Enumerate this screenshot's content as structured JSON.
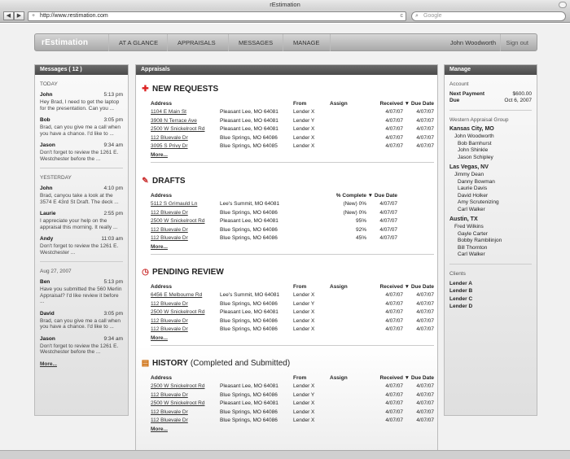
{
  "window": {
    "title": "rEstimation"
  },
  "browser": {
    "url": "http://www.restimation.com",
    "search_placeholder": "Google",
    "back_label": "◀",
    "fwd_label": "▶",
    "plus": "+",
    "reload": "c"
  },
  "nav": {
    "logo": "rEstimation",
    "items": [
      "AT A GLANCE",
      "APPRAISALS",
      "MESSAGES",
      "MANAGE"
    ],
    "user": "John Woodworth",
    "signout": "Sign out"
  },
  "messages": {
    "title": "Messages ( 12 )",
    "groups": [
      {
        "label": "TODAY",
        "items": [
          {
            "from": "John",
            "time": "5:13 pm",
            "body": "Hey Brad, I need to get the laptop for the presentation. Can you ..."
          },
          {
            "from": "Bob",
            "time": "3:05 pm",
            "body": "Brad, can you give me a call when you have a chance. I'd like to ..."
          },
          {
            "from": "Jason",
            "time": "9:34 am",
            "body": "Don't forget to review the 1261 E. Westchester before the ..."
          }
        ]
      },
      {
        "label": "YESTERDAY",
        "items": [
          {
            "from": "John",
            "time": "4:10 pm",
            "body": "Brad, canyou take a look at the 3574 E 43rd St Draft. The deck ..."
          },
          {
            "from": "Laurie",
            "time": "2:55 pm",
            "body": "I appreciate your help on the appraisal this morning. It really ..."
          },
          {
            "from": "Andy",
            "time": "11:03 am",
            "body": "Don't forget to review the 1261 E. Westchester ..."
          }
        ]
      },
      {
        "label": "Aug 27, 2007",
        "items": [
          {
            "from": "Ben",
            "time": "5:13 pm",
            "body": "Have you submitted the 560 Merlin Appraisal? I'd like review it before ..."
          },
          {
            "from": "David",
            "time": "3:05 pm",
            "body": "Brad, can you give me a call when you have a chance. I'd like to ..."
          },
          {
            "from": "Jason",
            "time": "9:34 am",
            "body": "Don't forget to review the 1261 E. Westchester before the ..."
          }
        ]
      }
    ],
    "more": "More..."
  },
  "appraisals": {
    "title": "Appraisals",
    "more": "More...",
    "new_requests": {
      "title": "NEW REQUESTS",
      "icon": "✚",
      "headers": [
        "Address",
        "",
        "From",
        "Assign",
        "Received",
        "▼ Due Date"
      ],
      "rows": [
        [
          "1104 E Main St",
          "Pleasant Lee, MO 64081",
          "Lender X",
          "",
          "4/07/07",
          "4/07/07"
        ],
        [
          "3908 N Terrace Ave",
          "Pleasant Lee, MO 64081",
          "Lender Y",
          "",
          "4/07/07",
          "4/07/07"
        ],
        [
          "2500 W Snickelroot Rd",
          "Pleasant Lee, MO 64081",
          "Lender X",
          "",
          "4/07/07",
          "4/07/07"
        ],
        [
          "112 Bluevale Dr",
          "Blue Springs, MO 64086",
          "Lender X",
          "",
          "4/07/07",
          "4/07/07"
        ],
        [
          "3095 S Privy Dr",
          "Blue Springs, MO 64085",
          "Lender X",
          "",
          "4/07/07",
          "4/07/07"
        ]
      ]
    },
    "drafts": {
      "title": "DRAFTS",
      "icon": "✎",
      "headers": [
        "Address",
        "",
        "% Complete",
        "▼ Due Date"
      ],
      "rows": [
        [
          "5112 S Grimauld Ln",
          "Lee's Summit, MO 64081",
          "(New) 0%",
          "4/07/07"
        ],
        [
          "112 Bluevale Dr",
          "Blue Springs, MO 64086",
          "(New) 0%",
          "4/07/07"
        ],
        [
          "2500 W Snickelroot Rd",
          "Pleasant Lee, MO 64081",
          "95%",
          "4/07/07"
        ],
        [
          "112 Bluevale Dr",
          "Blue Springs, MO 64086",
          "92%",
          "4/07/07"
        ],
        [
          "112 Bluevale Dr",
          "Blue Springs, MO 64086",
          "45%",
          "4/07/07"
        ]
      ]
    },
    "pending": {
      "title": "PENDING REVIEW",
      "icon": "◷",
      "headers": [
        "Address",
        "",
        "From",
        "Assign",
        "Received",
        "▼ Due Date"
      ],
      "rows": [
        [
          "6456 E Melbourne Rd",
          "Lee's Summit, MO 64081",
          "Lender X",
          "",
          "4/07/07",
          "4/07/07"
        ],
        [
          "112 Bluevale Dr",
          "Blue Springs, MO 64086",
          "Lender Y",
          "",
          "4/07/07",
          "4/07/07"
        ],
        [
          "2500 W Snickelroot Rd",
          "Pleasant Lee, MO 64081",
          "Lender X",
          "",
          "4/07/07",
          "4/07/07"
        ],
        [
          "112 Bluevale Dr",
          "Blue Springs, MO 64086",
          "Lender X",
          "",
          "4/07/07",
          "4/07/07"
        ],
        [
          "112 Bluevale Dr",
          "Blue Springs, MO 64086",
          "Lender X",
          "",
          "4/07/07",
          "4/07/07"
        ]
      ]
    },
    "history": {
      "title": "HISTORY",
      "subtitle": "(Completed and Submitted)",
      "icon": "▤",
      "headers": [
        "Address",
        "",
        "From",
        "Assign",
        "Received",
        "▼ Due Date"
      ],
      "rows": [
        [
          "2500 W Snickelroot Rd",
          "Pleasant Lee, MO 64081",
          "Lender X",
          "",
          "4/07/07",
          "4/07/07"
        ],
        [
          "112 Bluevale Dr",
          "Blue Springs, MO 64086",
          "Lender Y",
          "",
          "4/07/07",
          "4/07/07"
        ],
        [
          "2500 W Snickelroot Rd",
          "Pleasant Lee, MO 64081",
          "Lender X",
          "",
          "4/07/07",
          "4/07/07"
        ],
        [
          "112 Bluevale Dr",
          "Blue Springs, MO 64086",
          "Lender X",
          "",
          "4/07/07",
          "4/07/07"
        ],
        [
          "112 Bluevale Dr",
          "Blue Springs, MO 64086",
          "Lender X",
          "",
          "4/07/07",
          "4/07/07"
        ]
      ]
    }
  },
  "manage": {
    "title": "Manage",
    "account_label": "Account",
    "next_payment_label": "Next Payment",
    "next_payment_value": "$600.00",
    "due_label": "Due",
    "due_value": "Oct 6, 2007",
    "group_label": "Western Appraisal Group",
    "cities": [
      {
        "name": "Kansas City, MO",
        "lead": "John Woodworth",
        "members": [
          "Bob Barnhurst",
          "John Shinkle",
          "Jason Schipley"
        ]
      },
      {
        "name": "Las Vegas, NV",
        "lead": "Jimmy Dean",
        "members": [
          "Danny Bowman",
          "Laurie Davis",
          "David Holker",
          "Amy Scrutenizing",
          "Carl Walker"
        ]
      },
      {
        "name": "Austin, TX",
        "lead": "Fred Wilkins",
        "members": [
          "Gayle Carter",
          "Bobby Rambilinjon",
          "Bill Thornton",
          "Carl Walker"
        ]
      }
    ],
    "clients_label": "Clients",
    "clients": [
      "Lender A",
      "Lender B",
      "Lender C",
      "Lender D"
    ]
  }
}
